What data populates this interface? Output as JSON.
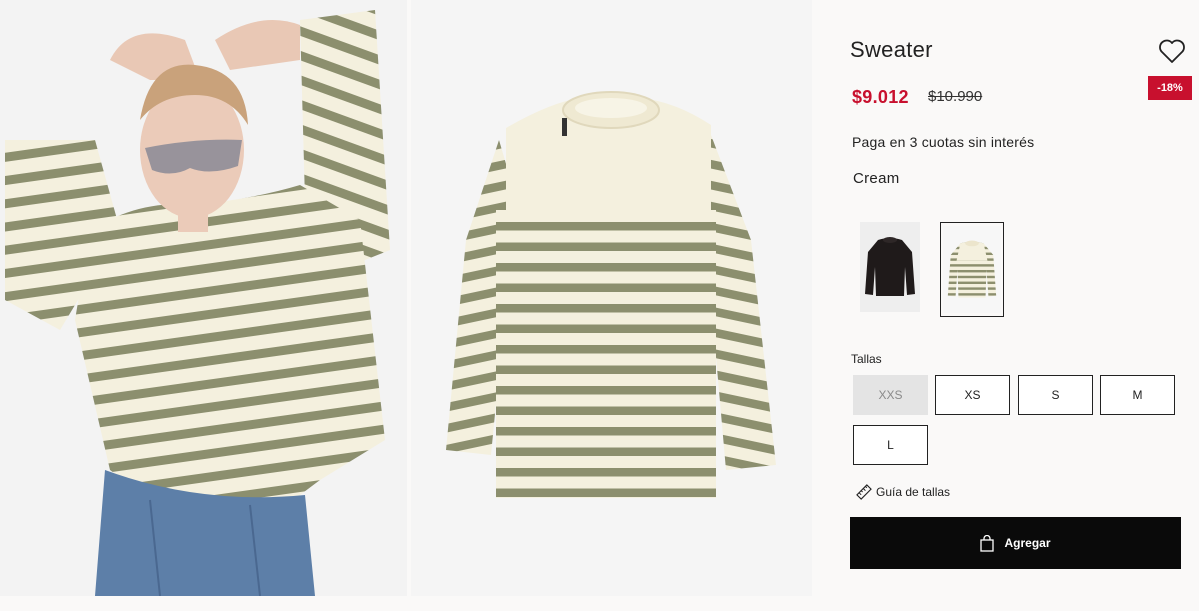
{
  "product": {
    "title": "Sweater",
    "price_sale": "$9.012",
    "price_original": "$10.990",
    "discount_badge": "-18%",
    "installments": "Paga en 3 cuotas sin interés",
    "color_name": "Cream"
  },
  "colors": {
    "stripe": "#8c8f6e",
    "cream": "#f4f0de",
    "sale_red": "#c8102e",
    "button_black": "#0a0a0a"
  },
  "swatches": [
    {
      "name": "dark",
      "selected": false
    },
    {
      "name": "cream-striped",
      "selected": true
    }
  ],
  "sizes": {
    "label": "Tallas",
    "options": [
      {
        "label": "XXS",
        "available": false
      },
      {
        "label": "XS",
        "available": true
      },
      {
        "label": "S",
        "available": true
      },
      {
        "label": "M",
        "available": true
      },
      {
        "label": "L",
        "available": true
      }
    ]
  },
  "size_guide_label": "Guía de tallas",
  "add_button_label": "Agregar",
  "icons": {
    "wishlist": "heart-icon",
    "size_guide": "ruler-icon",
    "add": "shopping-bag-icon"
  }
}
